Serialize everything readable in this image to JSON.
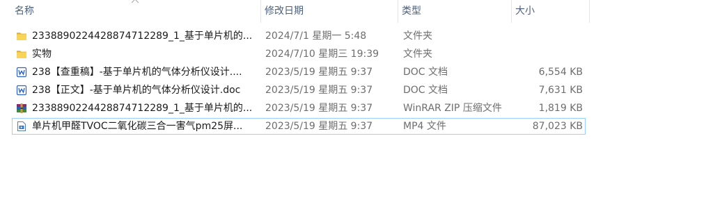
{
  "columns": {
    "name": "名称",
    "date": "修改日期",
    "type": "类型",
    "size": "大小"
  },
  "files": [
    {
      "name": "2338890224428874712289_1_基于单片机的...",
      "date": "2024/7/1 星期一 5:48",
      "type": "文件夹",
      "size": "",
      "icon": "folder-icon"
    },
    {
      "name": "实物",
      "date": "2024/7/10 星期三 19:39",
      "type": "文件夹",
      "size": "",
      "icon": "folder-icon"
    },
    {
      "name": "238【查重稿】-基于单片机的气体分析仪设计....",
      "date": "2023/5/19 星期五 9:37",
      "type": "DOC 文档",
      "size": "6,554 KB",
      "icon": "word-doc-icon"
    },
    {
      "name": "238【正文】-基于单片机的气体分析仪设计.doc",
      "date": "2023/5/19 星期五 9:37",
      "type": "DOC 文档",
      "size": "7,631 KB",
      "icon": "word-doc-icon"
    },
    {
      "name": "2338890224428874712289_1_基于单片机的...",
      "date": "2023/5/19 星期五 9:37",
      "type": "WinRAR ZIP 压缩文件",
      "size": "1,819 KB",
      "icon": "winrar-archive-icon"
    },
    {
      "name": "单片机甲醛TVOC二氧化碳三合一害气pm25屏...",
      "date": "2023/5/19 星期五 9:37",
      "type": "MP4 文件",
      "size": "87,023 KB",
      "icon": "video-file-icon"
    }
  ],
  "colors": {
    "header_text": "#4c607a",
    "selection_border": "#99d1ff",
    "folder": "#f4c542"
  }
}
